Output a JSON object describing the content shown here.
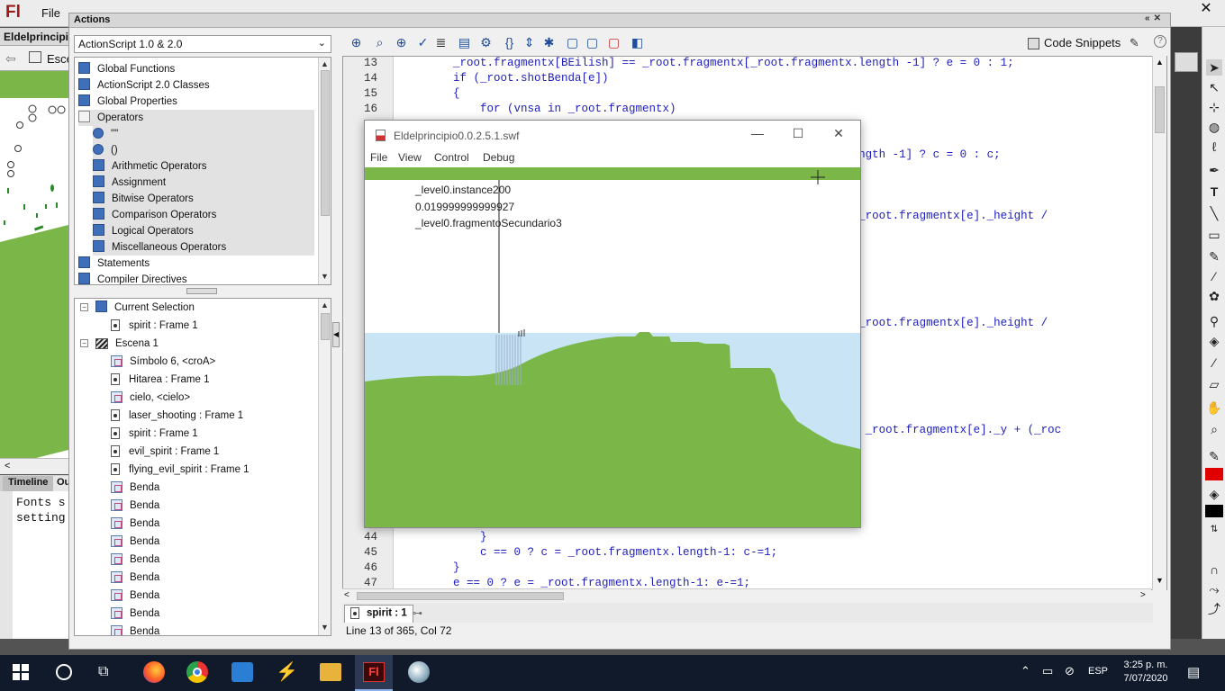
{
  "app": {
    "logo": "Fl",
    "menu": {
      "file": "File"
    },
    "close": "✕",
    "doc_tab": "Eldelprincipio",
    "scene_crumb": "Esce"
  },
  "timeline": {
    "tabs": [
      "Timeline",
      "Ou"
    ],
    "output_lines": [
      "Fonts s",
      "setting"
    ]
  },
  "actions_panel": {
    "title": "Actions",
    "language": "ActionScript 1.0 & 2.0",
    "toolbox": [
      {
        "label": "Global Functions",
        "icon": "book"
      },
      {
        "label": "ActionScript 2.0 Classes",
        "icon": "book"
      },
      {
        "label": "Global Properties",
        "icon": "book"
      },
      {
        "label": "Operators",
        "icon": "book-open"
      },
      {
        "label": "\"\"",
        "icon": "circle",
        "indent": true
      },
      {
        "label": "()",
        "icon": "circle",
        "indent": true
      },
      {
        "label": "Arithmetic Operators",
        "icon": "book",
        "indent": true
      },
      {
        "label": "Assignment",
        "icon": "book",
        "indent": true
      },
      {
        "label": "Bitwise Operators",
        "icon": "book",
        "indent": true
      },
      {
        "label": "Comparison Operators",
        "icon": "book",
        "indent": true
      },
      {
        "label": "Logical Operators",
        "icon": "book",
        "indent": true
      },
      {
        "label": "Miscellaneous Operators",
        "icon": "book",
        "indent": true
      },
      {
        "label": "Statements",
        "icon": "book"
      },
      {
        "label": "Compiler Directives",
        "icon": "book"
      }
    ],
    "navigator": [
      {
        "label": "Current Selection",
        "icon": "arrow",
        "level": 0,
        "expand": true
      },
      {
        "label": "spirit : Frame 1",
        "icon": "frame",
        "level": 1
      },
      {
        "label": "Escena 1",
        "icon": "scene",
        "level": 0,
        "expand": true
      },
      {
        "label": "Símbolo 6, <croA>",
        "icon": "symbol",
        "level": 1
      },
      {
        "label": "Hitarea : Frame 1",
        "icon": "frame",
        "level": 1
      },
      {
        "label": "cielo, <cielo>",
        "icon": "symbol",
        "level": 1
      },
      {
        "label": "laser_shooting : Frame 1",
        "icon": "frame",
        "level": 1
      },
      {
        "label": "spirit : Frame 1",
        "icon": "frame",
        "level": 1
      },
      {
        "label": "evil_spirit : Frame 1",
        "icon": "frame",
        "level": 1
      },
      {
        "label": "flying_evil_spirit : Frame 1",
        "icon": "frame",
        "level": 1
      },
      {
        "label": "Benda",
        "icon": "symbol",
        "level": 1
      },
      {
        "label": "Benda",
        "icon": "symbol",
        "level": 1
      },
      {
        "label": "Benda",
        "icon": "symbol",
        "level": 1
      },
      {
        "label": "Benda",
        "icon": "symbol",
        "level": 1
      },
      {
        "label": "Benda",
        "icon": "symbol",
        "level": 1
      },
      {
        "label": "Benda",
        "icon": "symbol",
        "level": 1
      },
      {
        "label": "Benda",
        "icon": "symbol",
        "level": 1
      },
      {
        "label": "Benda",
        "icon": "symbol",
        "level": 1
      },
      {
        "label": "Benda",
        "icon": "symbol",
        "level": 1
      }
    ],
    "code_snippets": "Code Snippets",
    "help": "?",
    "script_tab": "spirit : 1",
    "status": "Line 13 of 365, Col 72"
  },
  "code": [
    {
      "n": "13",
      "text": "        _root.fragmentx[BEilish] == _root.fragmentx[_root.fragmentx.length -1] ? e = 0 : 1;"
    },
    {
      "n": "14",
      "text": "        if (_root.shotBenda[e])"
    },
    {
      "n": "15",
      "text": "        {"
    },
    {
      "n": "16",
      "text": "            for (vnsa in _root.fragmentx)"
    },
    {
      "n": "",
      "text": ""
    },
    {
      "n": "",
      "text": ""
    },
    {
      "n": "",
      "text": "                                                         ragmentx.length -1] ? c = 0 : c;"
    },
    {
      "n": "",
      "text": ""
    },
    {
      "n": "",
      "text": ""
    },
    {
      "n": "",
      "text": ""
    },
    {
      "n": "",
      "text": "                                                         x[e]._y + (_root.fragmentx[e]._height /"
    },
    {
      "n": "",
      "text": ""
    },
    {
      "n": "",
      "text": ""
    },
    {
      "n": "",
      "text": ""
    },
    {
      "n": "",
      "text": ""
    },
    {
      "n": "",
      "text": ""
    },
    {
      "n": "",
      "text": ""
    },
    {
      "n": "",
      "text": "                                                         x[e]._y + (_root.fragmentx[e]._height /"
    },
    {
      "n": "",
      "text": ""
    },
    {
      "n": "",
      "text": ""
    },
    {
      "n": "",
      "text": ""
    },
    {
      "n": "",
      "text": ""
    },
    {
      "n": "",
      "text": ""
    },
    {
      "n": "",
      "text": ""
    },
    {
      "n": "",
      "text": "                                                         h - 1]._y > _root.fragmentx[e]._y + (_roc"
    },
    {
      "n": "",
      "text": ""
    },
    {
      "n": "",
      "text": "                                                         1]._y--;"
    },
    {
      "n": "",
      "text": ""
    },
    {
      "n": "",
      "text": ""
    },
    {
      "n": "",
      "text": ""
    },
    {
      "n": "",
      "text": ""
    },
    {
      "n": "44",
      "text": "            }"
    },
    {
      "n": "45",
      "text": "            c == 0 ? c = _root.fragmentx.length-1: c-=1;"
    },
    {
      "n": "46",
      "text": "        }"
    },
    {
      "n": "47",
      "text": "        e == 0 ? e = _root.fragmentx.length-1: e-=1;"
    }
  ],
  "swf_window": {
    "title": "Eldelprincipio0.0.2.5.1.swf",
    "menu": [
      "File",
      "View",
      "Control",
      "Debug"
    ],
    "debug_lines": [
      "_level0.instance200",
      "0.019999999999927",
      "_level0.fragmentoSecundario3"
    ],
    "colors": {
      "ground": "#7ab648",
      "sky": "#c9e4f5"
    }
  },
  "taskbar": {
    "language": "ESP",
    "time": "3:25 p. m.",
    "date": "7/07/2020"
  },
  "colors": {
    "accent_red": "#9b1b1b",
    "ground_green": "#7ab648",
    "code_blue": "#1d1dbd"
  }
}
